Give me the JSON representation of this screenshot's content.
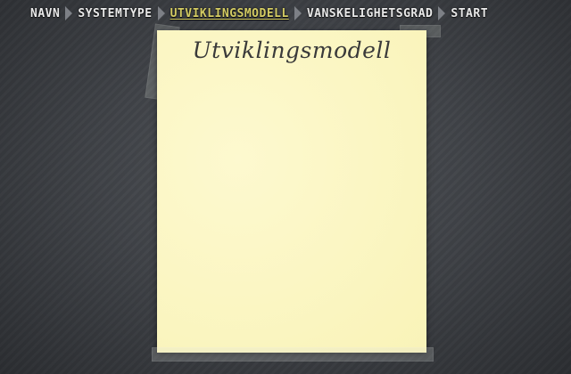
{
  "breadcrumb": {
    "items": [
      {
        "label": "NAVN",
        "active": false
      },
      {
        "label": "SYSTEMTYPE",
        "active": false
      },
      {
        "label": "UTVIKLINGSMODELL",
        "active": true
      },
      {
        "label": "VANSKELIGHETSGRAD",
        "active": false
      },
      {
        "label": "START",
        "active": false
      }
    ]
  },
  "note": {
    "title": "Utviklingsmodell"
  },
  "colors": {
    "background": "#3a3d42",
    "active_crumb": "#d4cc63",
    "crumb": "#e9e9e9",
    "note_paper": "#fcf8c8"
  }
}
